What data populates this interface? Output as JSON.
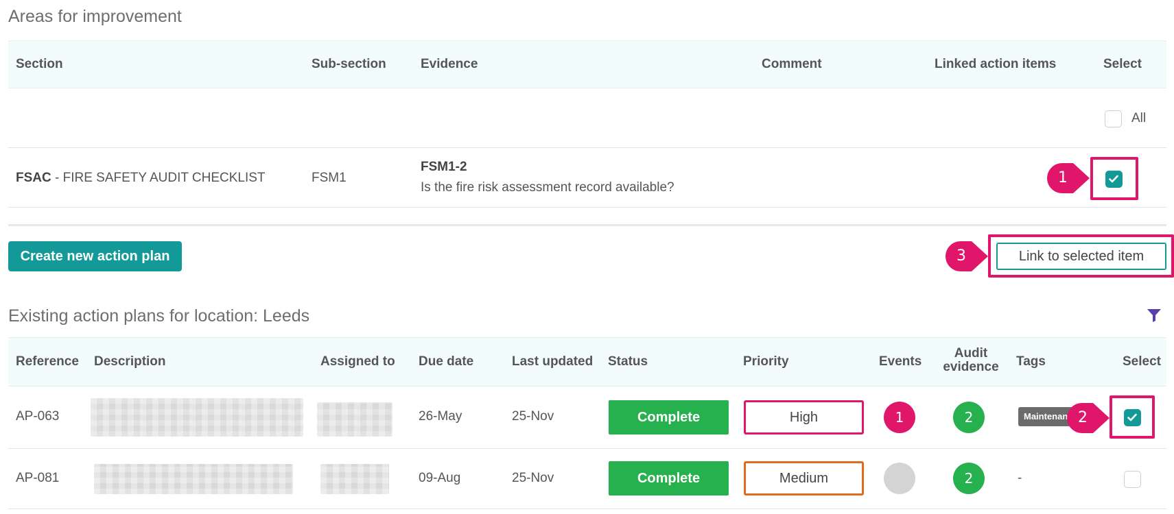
{
  "improvement": {
    "title": "Areas for improvement",
    "columns": {
      "section": "Section",
      "subsection": "Sub-section",
      "evidence": "Evidence",
      "comment": "Comment",
      "linked": "Linked action items",
      "select": "Select"
    },
    "select_all_label": "All",
    "row": {
      "section_code": "FSAC",
      "section_name": "- FIRE SAFETY AUDIT CHECKLIST",
      "subsection": "FSM1",
      "evidence_code": "FSM1-2",
      "evidence_question": "Is the fire risk assessment record available?",
      "selected": true
    }
  },
  "actions": {
    "create_label": "Create new action plan",
    "link_label": "Link to selected item"
  },
  "existing": {
    "title": "Existing action plans for location: Leeds",
    "filter_icon": "filter-icon",
    "columns": {
      "reference": "Reference",
      "description": "Description",
      "assigned": "Assigned to",
      "due": "Due date",
      "updated": "Last updated",
      "status": "Status",
      "priority": "Priority",
      "events": "Events",
      "audit_line1": "Audit",
      "audit_line2": "evidence",
      "tags": "Tags",
      "select": "Select"
    },
    "rows": [
      {
        "reference": "AP-063",
        "due": "26-May",
        "updated": "25-Nov",
        "status": "Complete",
        "priority": "High",
        "priority_color": "#e0166b",
        "events": "1",
        "audit_evidence": "2",
        "tag": "Maintenance",
        "selected": true
      },
      {
        "reference": "AP-081",
        "due": "09-Aug",
        "updated": "25-Nov",
        "status": "Complete",
        "priority": "Medium",
        "priority_color": "#e06a1b",
        "events": "",
        "audit_evidence": "2",
        "tag": "-",
        "selected": false
      }
    ]
  },
  "annotations": {
    "step1": "1",
    "step2": "2",
    "step3": "3",
    "color": "#e0166b"
  },
  "colors": {
    "accent": "#139a98",
    "complete": "#27b04e",
    "header_bg": "#f2fcfd"
  }
}
